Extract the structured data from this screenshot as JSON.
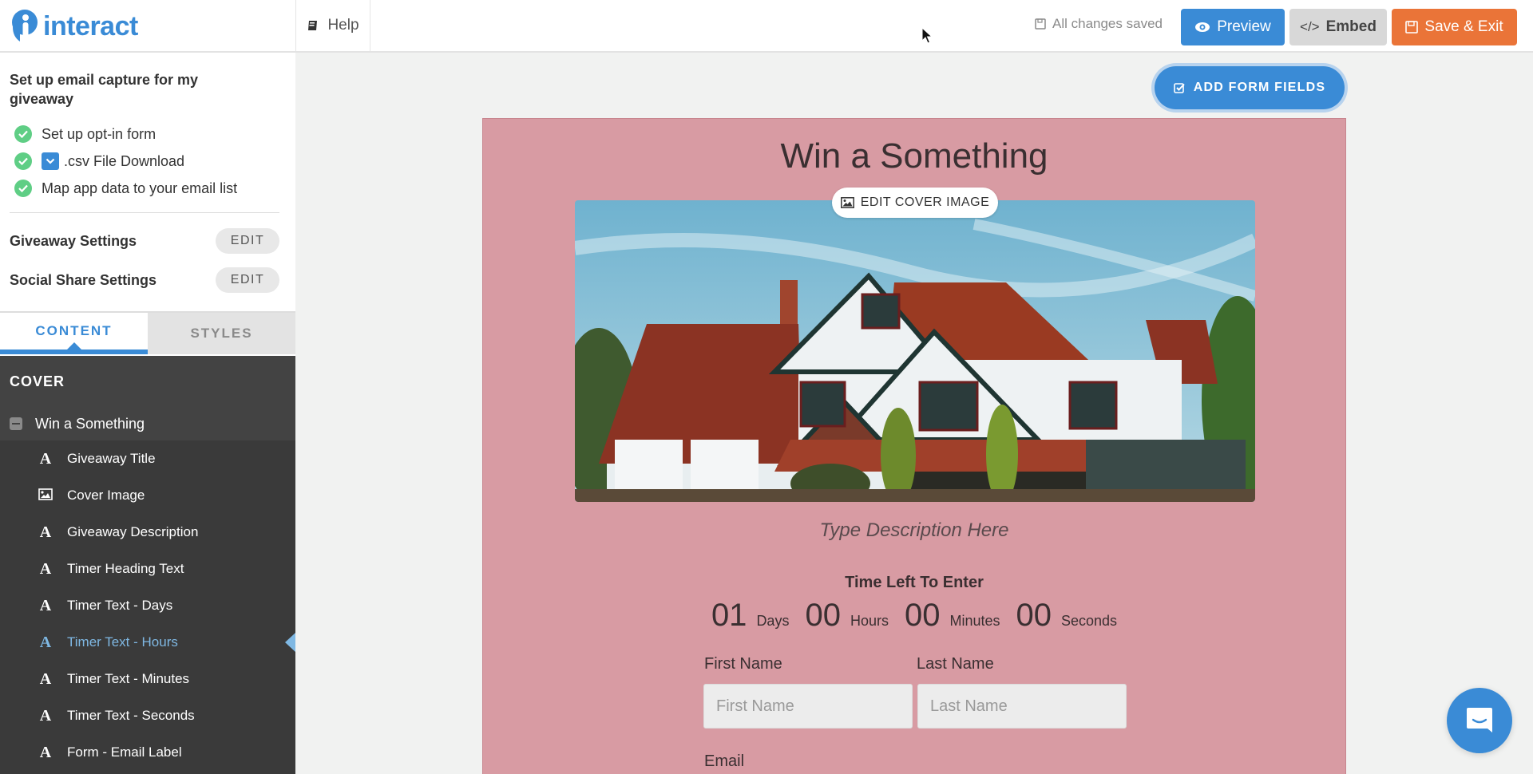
{
  "app": {
    "name": "interact",
    "brand_color": "#3a8bd6"
  },
  "header": {
    "help_label": "Help",
    "save_status": "All changes saved",
    "preview_label": "Preview",
    "embed_label": "Embed",
    "save_exit_label": "Save & Exit"
  },
  "sidebar": {
    "task_title": "Set up email capture for my giveaway",
    "tasks": [
      {
        "label": "Set up opt-in form",
        "done": true
      },
      {
        "label": ".csv File Download",
        "done": true
      },
      {
        "label": "Map app data to your email list",
        "done": true
      }
    ],
    "settings": [
      {
        "label": "Giveaway Settings",
        "button": "EDIT"
      },
      {
        "label": "Social Share Settings",
        "button": "EDIT"
      }
    ],
    "tabs": [
      {
        "label": "CONTENT",
        "active": true
      },
      {
        "label": "STYLES",
        "active": false
      }
    ],
    "section_header": "COVER",
    "group_label": "Win a Something",
    "items": [
      {
        "label": "Giveaway Title",
        "icon": "text-icon"
      },
      {
        "label": "Cover Image",
        "icon": "image-icon"
      },
      {
        "label": "Giveaway Description",
        "icon": "text-icon"
      },
      {
        "label": "Timer Heading Text",
        "icon": "text-icon"
      },
      {
        "label": "Timer Text - Days",
        "icon": "text-icon"
      },
      {
        "label": "Timer Text - Hours",
        "icon": "text-icon",
        "active": true
      },
      {
        "label": "Timer Text - Minutes",
        "icon": "text-icon"
      },
      {
        "label": "Timer Text - Seconds",
        "icon": "text-icon"
      },
      {
        "label": "Form - Email Label",
        "icon": "text-icon"
      }
    ]
  },
  "editor": {
    "add_form_fields_label": "ADD FORM FIELDS",
    "giveaway_title": "Win a Something",
    "edit_cover_label": "EDIT COVER IMAGE",
    "description": "Type Description Here",
    "timer_heading": "Time Left To Enter",
    "timer": [
      {
        "value": "01",
        "unit": "Days"
      },
      {
        "value": "00",
        "unit": "Hours"
      },
      {
        "value": "00",
        "unit": "Minutes"
      },
      {
        "value": "00",
        "unit": "Seconds"
      }
    ],
    "form": {
      "first_name_label": "First Name",
      "first_name_placeholder": "First Name",
      "last_name_label": "Last Name",
      "last_name_placeholder": "Last Name",
      "email_label": "Email"
    },
    "canvas_bg": "#d89ba3"
  }
}
